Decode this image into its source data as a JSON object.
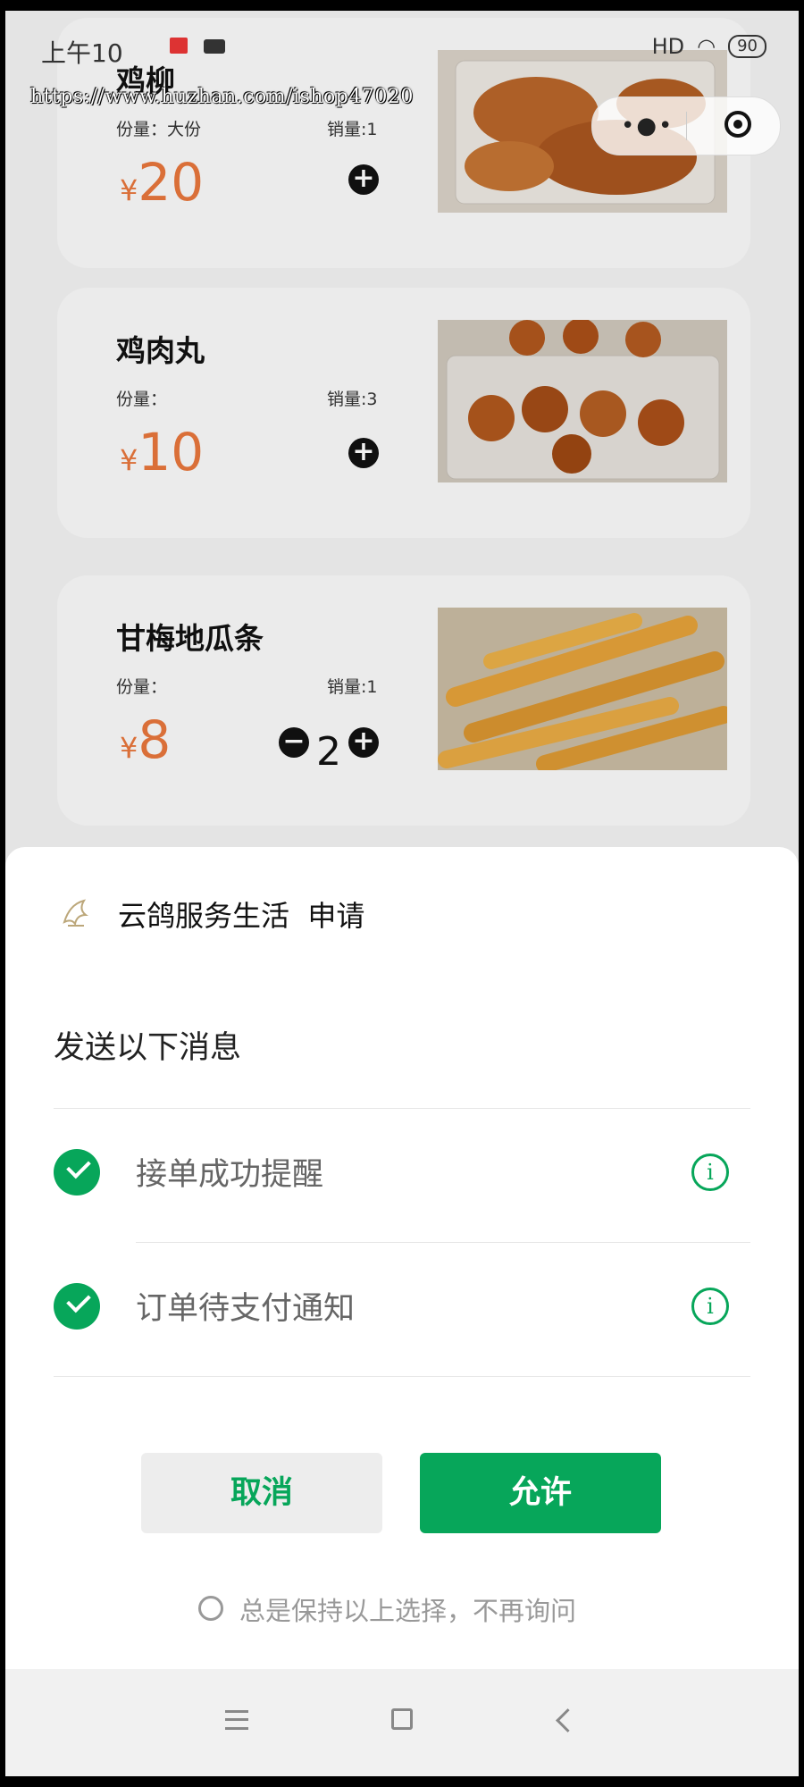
{
  "status_bar": {
    "time": "上午10",
    "network": "HD",
    "battery": "90"
  },
  "watermark": "https://www.huzhan.com/ishop47020",
  "colors": {
    "accent": "#07a65a",
    "price": "#e8763c"
  },
  "products": [
    {
      "name": "鸡柳",
      "portion": "份量：大份",
      "sales": "销量:1",
      "currency": "¥",
      "price": "20",
      "quantity": ""
    },
    {
      "name": "鸡肉丸",
      "portion": "份量：",
      "sales": "销量:3",
      "currency": "¥",
      "price": "10",
      "quantity": ""
    },
    {
      "name": "甘梅地瓜条",
      "portion": "份量：",
      "sales": "销量:1",
      "currency": "¥",
      "price": "8",
      "quantity": "2"
    }
  ],
  "dialog": {
    "app_name": "云鸽服务生活",
    "action": "申请",
    "subtitle": "发送以下消息",
    "options": [
      {
        "label": "接单成功提醒",
        "checked": true
      },
      {
        "label": "订单待支付通知",
        "checked": true
      }
    ],
    "cancel_label": "取消",
    "allow_label": "允许",
    "remember_label": "总是保持以上选择，不再询问"
  }
}
